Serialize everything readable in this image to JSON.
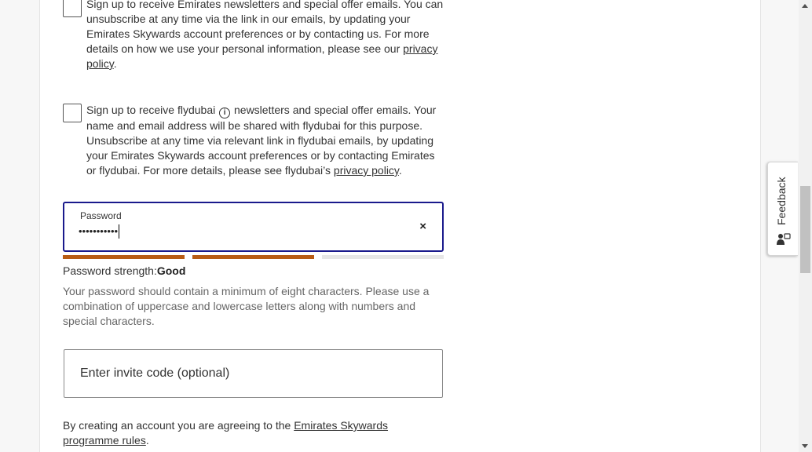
{
  "consent_emirates": {
    "text_before": "Sign up to receive Emirates newsletters and special offer emails. You can unsubscribe at any time via the link in our emails, by updating your Emirates Skywards account preferences or by contacting us. For more details on how we use your personal information, please see our ",
    "link": "privacy policy",
    "text_after": ".",
    "checked": false
  },
  "consent_flydubai": {
    "text_before": "Sign up to receive flydubai ",
    "info_icon": "info-icon",
    "text_middle": " newsletters and special offer emails. Your name and email address will be shared with flydubai for this purpose. Unsubscribe at any time via relevant link in flydubai emails, by updating your Emirates Skywards account preferences or by contacting Emirates or flydubai. For more details, please see flydubai’s ",
    "link": "privacy policy",
    "text_after": ".",
    "checked": false
  },
  "password": {
    "label": "Password",
    "masked_value": "•••••••••••",
    "clear_icon": "close-icon",
    "clear_glyph": "×"
  },
  "strength": {
    "label": "Password strength:",
    "value": "Good",
    "filled_segments": 2,
    "total_segments": 3,
    "filled_color": "#b85c14",
    "empty_color": "#e6e6e6"
  },
  "hint": "Your password should contain a minimum of eight characters. Please use a combination of uppercase and lowercase letters along with numbers and special characters.",
  "invite": {
    "placeholder": "Enter invite code (optional)"
  },
  "agreement": {
    "text_before": "By creating an account you are agreeing to the ",
    "link": "Emirates Skywards programme rules",
    "text_after": "."
  },
  "feedback": {
    "label": "Feedback",
    "icon": "feedback-person-icon"
  },
  "colors": {
    "focus_border": "#1a1a8c",
    "text": "#333333",
    "hint_text": "#666666"
  }
}
